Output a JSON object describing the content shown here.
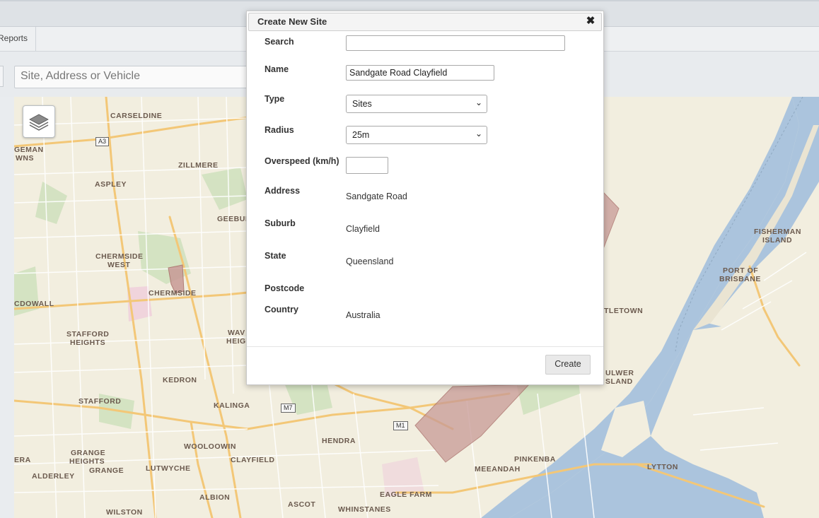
{
  "nav": {
    "reports_tab": "Reports"
  },
  "search": {
    "placeholder": "Site, Address or Vehicle"
  },
  "map": {
    "labels": {
      "carseldine": "CARSELDINE",
      "geman_1": "GEMAN",
      "geman_2": "WNS",
      "zillmere": "ZILLMERE",
      "aspley": "ASPLEY",
      "geebung": "GEEBUN",
      "chermside_west_1": "CHERMSIDE",
      "chermside_west_2": "WEST",
      "chermside": "CHERMSIDE",
      "mcdowall": "CDOWALL",
      "stafford_heights_1": "STAFFORD",
      "stafford_heights_2": "HEIGHTS",
      "wavell_1": "WAV",
      "wavell_2": "HEIG",
      "kedron": "KEDRON",
      "stafford": "STAFFORD",
      "kalinga": "KALINGA",
      "grange_heights_1": "GRANGE",
      "grange_heights_2": "HEIGHTS",
      "era": "ERA",
      "grange": "GRANGE",
      "lutwyche": "LUTWYCHE",
      "wooloowin": "WOOLOOWIN",
      "clayfield": "CLAYFIELD",
      "hendra": "HENDRA",
      "alderley": "ALDERLEY",
      "albion": "ALBION",
      "ascot": "ASCOT",
      "whinstanes": "WHINSTANES",
      "eagle_farm": "EAGLE FARM",
      "meeandah": "MEEANDAH",
      "pinkenba": "PINKENBA",
      "lytton": "LYTTON",
      "wilston": "WILSTON",
      "fisherman_island_1": "FISHERMAN",
      "fisherman_island_2": "ISLAND",
      "port_of_brisbane_1": "PORT OF",
      "port_of_brisbane_2": "BRISBANE",
      "myrtletown": "TLETOWN",
      "bulwer_island_1": "ULWER",
      "bulwer_island_2": "SLAND"
    },
    "shields": {
      "a3": "A3",
      "m7": "M7",
      "m1": "M1"
    },
    "colors": {
      "land": "#f2eedf",
      "water": "#abc4dd",
      "major_road": "#f3c777",
      "minor_road": "#ffffff",
      "park": "#cfe0bd",
      "site_polygon": "#c89a96"
    }
  },
  "modal": {
    "title": "Create New Site",
    "fields": {
      "search": {
        "label": "Search",
        "value": ""
      },
      "name": {
        "label": "Name",
        "value": "Sandgate Road Clayfield"
      },
      "type": {
        "label": "Type",
        "value": "Sites"
      },
      "radius": {
        "label": "Radius",
        "value": "25m"
      },
      "overspeed": {
        "label": "Overspeed (km/h)",
        "value": ""
      },
      "address": {
        "label": "Address",
        "value": "Sandgate Road"
      },
      "suburb": {
        "label": "Suburb",
        "value": "Clayfield"
      },
      "state": {
        "label": "State",
        "value": "Queensland"
      },
      "postcode": {
        "label": "Postcode",
        "value": ""
      },
      "country": {
        "label": "Country",
        "value": "Australia"
      }
    },
    "create_label": "Create"
  }
}
